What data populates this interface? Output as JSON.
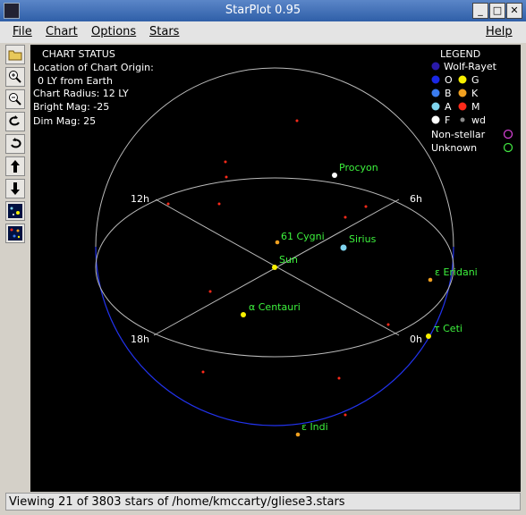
{
  "window": {
    "title": "StarPlot 0.95",
    "minimize": "_",
    "maximize": "□",
    "close": "✕"
  },
  "menu": {
    "file": "File",
    "chart": "Chart",
    "options": "Options",
    "stars": "Stars",
    "help": "Help"
  },
  "toolbar": {
    "tools": [
      "open-folder-icon",
      "zoom-in-icon",
      "zoom-out-icon",
      "rotate-left-icon",
      "rotate-right-icon",
      "arrow-up-icon",
      "arrow-down-icon",
      "star-field-icon",
      "color-stars-icon"
    ]
  },
  "chart_status": {
    "heading": "CHART STATUS",
    "origin_label": "Location of Chart Origin:",
    "origin_value": "0 LY from Earth",
    "radius": "Chart Radius: 12 LY",
    "bright_mag": "Bright Mag: -25",
    "dim_mag": "Dim Mag: 25"
  },
  "legend": {
    "heading": "LEGEND",
    "wolf_rayet": "Wolf-Rayet",
    "o": "O",
    "g": "G",
    "b": "B",
    "k": "K",
    "a": "A",
    "m": "M",
    "f": "F",
    "wd": "wd",
    "non_stellar": "Non-stellar",
    "unknown": "Unknown",
    "colors": {
      "wolf_rayet": "#2a1aa8",
      "o": "#1a28e6",
      "b": "#3a7cf0",
      "a": "#7fd4ee",
      "f": "#ffffff",
      "g": "#f8f000",
      "k": "#f0a020",
      "m": "#ff2a1a",
      "wd": "#8a8a8a",
      "non_stellar": "#d040d0",
      "unknown": "#40e040"
    }
  },
  "hours": {
    "h12": "12h",
    "h6": "6h",
    "h18": "18h",
    "h0": "0h"
  },
  "stars": {
    "procyon": "Procyon",
    "cygni61": "61 Cygni",
    "sirius": "Sirius",
    "sun": "Sun",
    "eridani": "ε Eridani",
    "centauri": "α Centauri",
    "ceti": "τ Ceti",
    "indi": "ε Indi"
  },
  "status_bar": "Viewing 21 of 3803 stars of /home/kmccarty/gliese3.stars"
}
